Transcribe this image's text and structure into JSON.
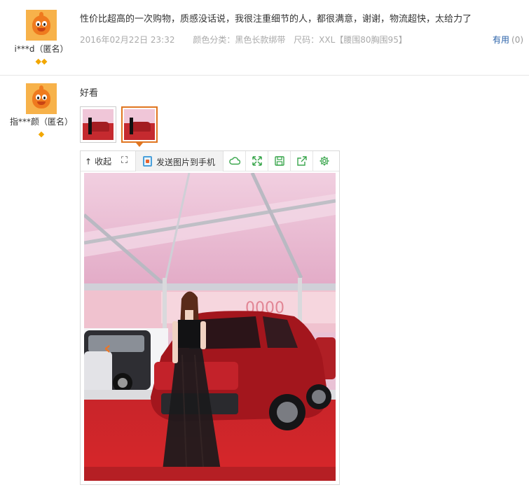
{
  "reviews": [
    {
      "user": "i***d（匿名）",
      "text": "性价比超高的一次购物，质感没话说，我很注重细节的人，都很满意，谢谢，物流超快，太给力了",
      "date": "2016年02月22日 23:32",
      "color_label": "颜色分类：黑色长款绑带",
      "size_label": "尺码：XXL【腰围80胸围95】",
      "useful_label": "有用",
      "useful_count": "(0)",
      "badge_icons": [
        "diamond-icon",
        "diamond-icon"
      ]
    },
    {
      "user": "指***颜（匿名）",
      "text": "好看",
      "badge_icons": [
        "diamond-icon"
      ],
      "thumbnails": [
        "photo-thumbnail",
        "photo-thumbnail"
      ],
      "viewer": {
        "collapse_label": "收起",
        "send_label": "发送图片到手机",
        "tool_icons": [
          "cloud-icon",
          "fullscreen-icon",
          "save-icon",
          "share-icon",
          "settings-icon"
        ]
      }
    }
  ],
  "colors": {
    "link": "#2a62a9",
    "accent": "#e07520",
    "toolbar_icon": "#3aa64d",
    "gem": "#f2a700"
  }
}
